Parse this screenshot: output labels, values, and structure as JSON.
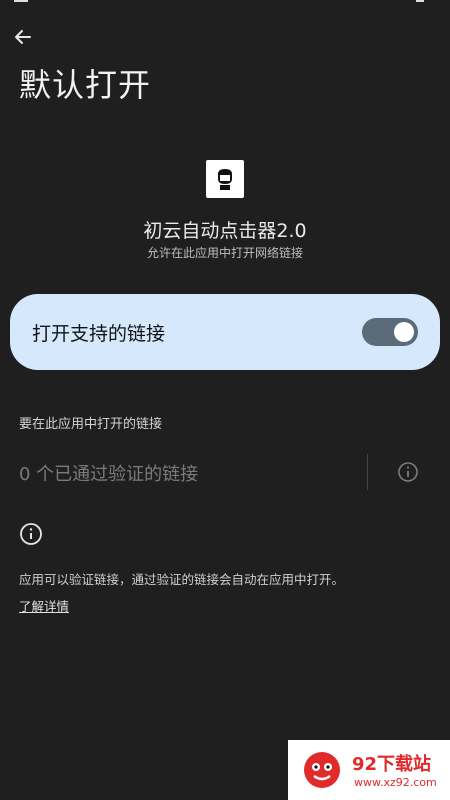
{
  "header": {
    "title": "默认打开"
  },
  "app": {
    "name": "初云自动点击器2.0",
    "subtitle": "允许在此应用中打开网络链接"
  },
  "toggle": {
    "label": "打开支持的链接",
    "state": "on"
  },
  "links_section": {
    "header": "要在此应用中打开的链接",
    "verified_links": "0 个已通过验证的链接"
  },
  "info": {
    "description": "应用可以验证链接，通过验证的链接会自动在应用中打开。",
    "learn_more": "了解详情"
  },
  "watermark": {
    "title": "92下载站",
    "url": "www.xz92.com"
  },
  "colors": {
    "background": "#1f1f1f",
    "toggle_card": "#d6e8fb",
    "switch_track": "#5b6b7a",
    "watermark_red": "#e12a2a"
  },
  "icons": [
    "back-arrow-icon",
    "app-icon",
    "info-icon",
    "info-outline-icon",
    "watermark-logo-icon"
  ]
}
